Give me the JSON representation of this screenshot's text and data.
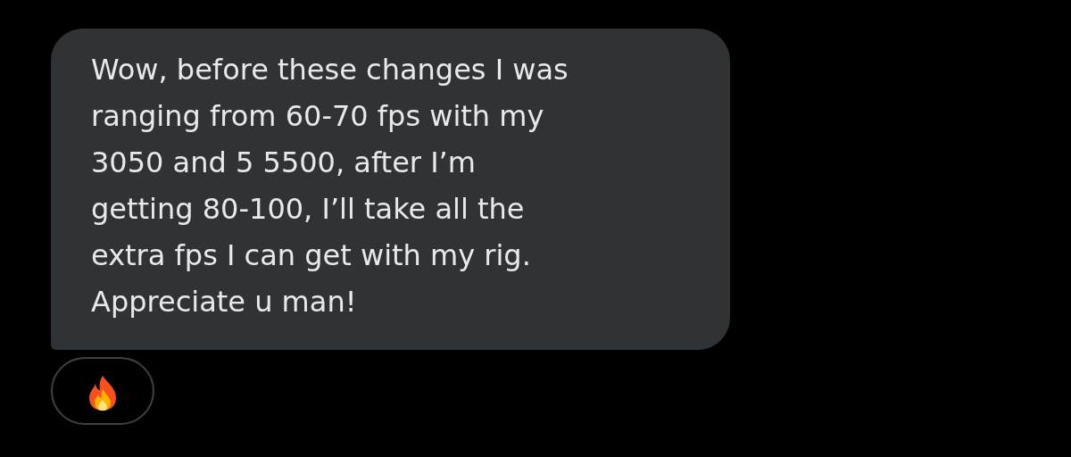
{
  "message": {
    "text": "Wow, before these changes I was\nranging from 60-70 fps with my\n3050 and 5 5500, after I’m\ngetting 80-100, I’ll take all the\nextra fps I can get with my rig.\nAppreciate u man!"
  },
  "reactions": [
    {
      "kind": "fire"
    }
  ]
}
